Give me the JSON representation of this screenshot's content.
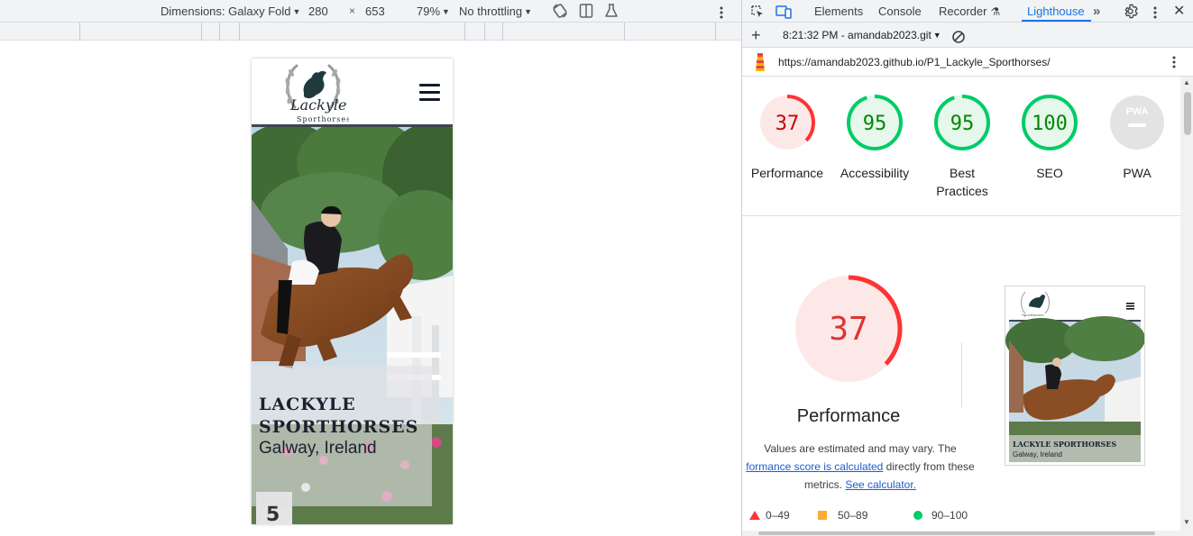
{
  "device_toolbar": {
    "dimensions_label": "Dimensions: Galaxy Fold",
    "width": "280",
    "times": "×",
    "height": "653",
    "zoom": "79%",
    "throttling": "No throttling"
  },
  "phone": {
    "logo_text": "Lackyle",
    "logo_sub": "Sporthorses",
    "hero_title_line1": "LACKYLE",
    "hero_title_line2": "SPORTHORSES",
    "hero_subtitle": "Galway, Ireland",
    "hurdle_number": "5"
  },
  "devtools": {
    "tabs": [
      "Elements",
      "Console",
      "Recorder",
      "Lighthouse"
    ],
    "active_tab": "Lighthouse",
    "report_selector": "8:21:32 PM - amandab2023.git",
    "url": "https://amandab2023.github.io/P1_Lackyle_Sporthorses/"
  },
  "scores": [
    {
      "name": "Performance",
      "score": "37",
      "value": 37,
      "color": "#f33",
      "text_color": "#c00",
      "bg": "#fde8e8"
    },
    {
      "name": "Accessibility",
      "score": "95",
      "value": 95,
      "color": "#0c6",
      "text_color": "#080",
      "bg": "#e6f7ec"
    },
    {
      "name": "Best Practices",
      "score": "95",
      "value": 95,
      "color": "#0c6",
      "text_color": "#080",
      "bg": "#e6f7ec"
    },
    {
      "name": "SEO",
      "score": "100",
      "value": 100,
      "color": "#0c6",
      "text_color": "#080",
      "bg": "#e6f7ec"
    },
    {
      "name": "PWA",
      "score": "PWA",
      "value": null,
      "color": "#ccc",
      "text_color": "#fff",
      "bg": "#e3e3e3"
    }
  ],
  "performance_detail": {
    "score": "37",
    "title": "Performance",
    "desc_line1": "Values are estimated and may vary. The",
    "desc_link1": "formance score is calculated",
    "desc_mid": " directly from these",
    "desc_line3": "metrics. ",
    "desc_link2": "See calculator."
  },
  "thumbnail": {
    "title": "LACKYLE SPORTHORSES",
    "subtitle": "Galway, Ireland"
  },
  "legend": [
    {
      "range": "0–49",
      "color": "#f33"
    },
    {
      "range": "50–89",
      "color": "#fa3"
    },
    {
      "range": "90–100",
      "color": "#0c6"
    }
  ]
}
